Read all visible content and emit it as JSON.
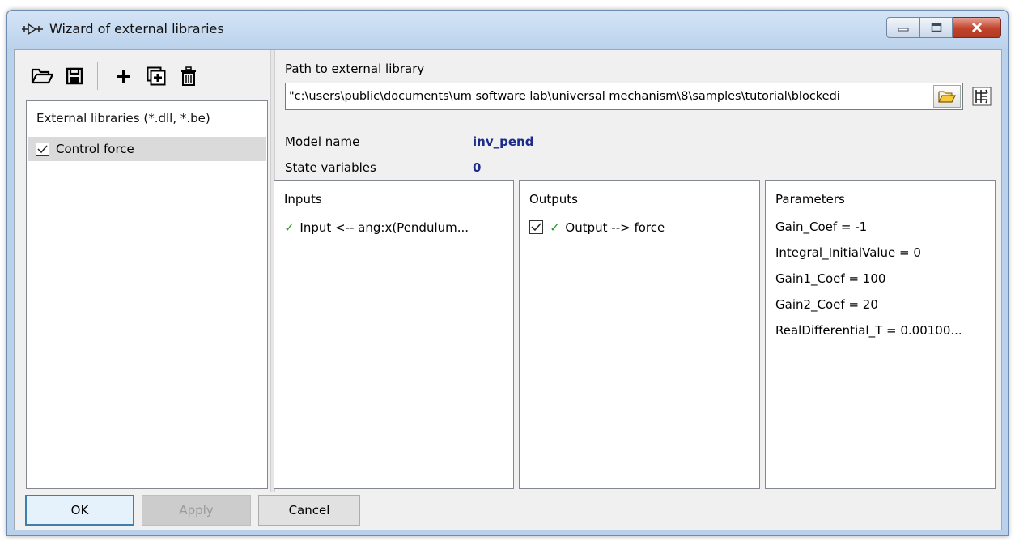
{
  "window": {
    "title": "Wizard of external libraries"
  },
  "toolbar": {
    "buttons": [
      {
        "name": "open-folder-icon"
      },
      {
        "name": "save-icon"
      },
      {
        "name": "add-icon"
      },
      {
        "name": "add-copy-icon"
      },
      {
        "name": "delete-icon"
      }
    ]
  },
  "libraries": {
    "header": "External libraries (*.dll, *.be)",
    "items": [
      {
        "label": "Control force",
        "checked": true
      }
    ]
  },
  "path": {
    "label": "Path to external library",
    "value": "\"c:\\users\\public\\documents\\um software lab\\universal mechanism\\8\\samples\\tutorial\\blockedi"
  },
  "model": {
    "name_label": "Model name",
    "name_value": "inv_pend",
    "state_label": "State variables",
    "state_value": "0"
  },
  "inputs": {
    "title": "Inputs",
    "items": [
      {
        "label": "Input <-- ang:x(Pendulum..."
      }
    ]
  },
  "outputs": {
    "title": "Outputs",
    "items": [
      {
        "label": "Output --> force",
        "checked": true
      }
    ]
  },
  "parameters": {
    "title": "Parameters",
    "items": [
      "Gain_Coef = -1",
      "Integral_InitialValue = 0",
      "Gain1_Coef = 100",
      "Gain2_Coef = 20",
      "RealDifferential_T = 0.00100..."
    ]
  },
  "buttons": {
    "ok": "OK",
    "apply": "Apply",
    "cancel": "Cancel"
  },
  "colors": {
    "accent": "#3c7fb1",
    "model_value": "#1c2c8c",
    "tick": "#2f9e2f",
    "close_button": "#c1432b"
  }
}
